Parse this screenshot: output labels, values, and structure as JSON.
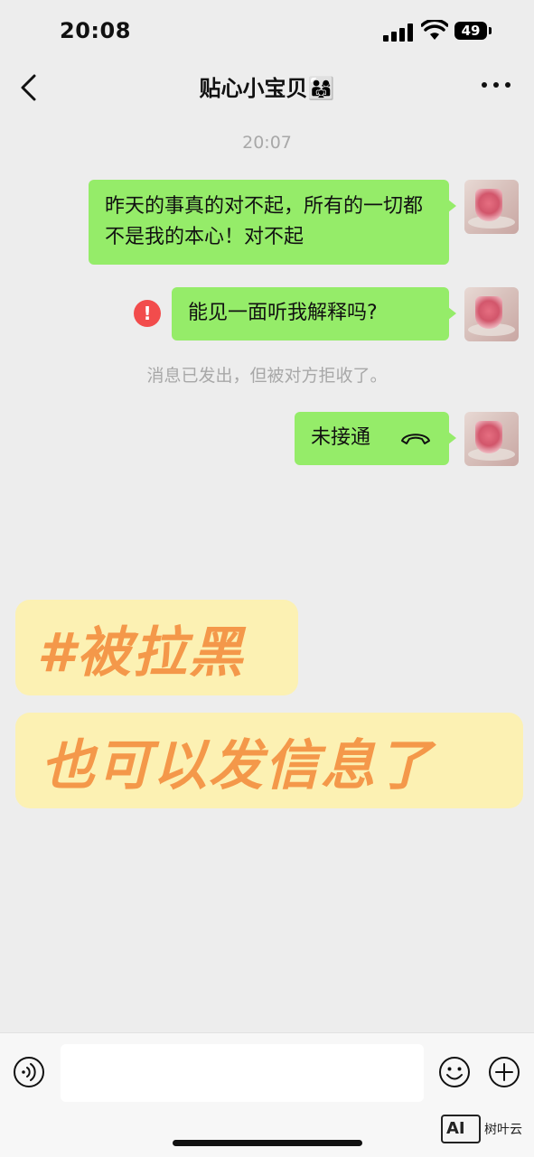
{
  "status_bar": {
    "time": "20:08",
    "battery": "49"
  },
  "nav": {
    "title": "贴心小宝贝👨‍👩‍👧"
  },
  "timestamp": "20:07",
  "messages": [
    {
      "text": "昨天的事真的对不起，所有的一切都不是我的本心！对不起"
    },
    {
      "text": "能见一面听我解释吗?"
    },
    {
      "text": "未接通"
    }
  ],
  "error_mark": "!",
  "system_note": "消息已发出，但被对方拒收了。",
  "overlay": {
    "line1": "#被拉黑",
    "line2": "也可以发信息了"
  },
  "input": {
    "placeholder": ""
  },
  "watermark": {
    "logo": "AI",
    "text": "树叶云"
  },
  "colors": {
    "bubble": "#95ec69",
    "error": "#f24c4c",
    "overlay_bg": "#fcf1b3",
    "overlay_text": "#f4984a"
  }
}
